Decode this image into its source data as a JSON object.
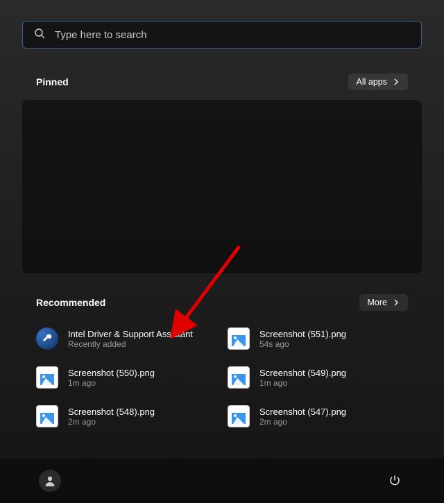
{
  "search": {
    "placeholder": "Type here to search"
  },
  "pinned": {
    "title": "Pinned",
    "all_apps_label": "All apps"
  },
  "recommended": {
    "title": "Recommended",
    "more_label": "More",
    "items": [
      {
        "title": "Intel Driver & Support Assistant",
        "subtitle": "Recently added",
        "icon": "intel"
      },
      {
        "title": "Screenshot (551).png",
        "subtitle": "54s ago",
        "icon": "image"
      },
      {
        "title": "Screenshot (550).png",
        "subtitle": "1m ago",
        "icon": "image"
      },
      {
        "title": "Screenshot (549).png",
        "subtitle": "1m ago",
        "icon": "image"
      },
      {
        "title": "Screenshot (548).png",
        "subtitle": "2m ago",
        "icon": "image"
      },
      {
        "title": "Screenshot (547).png",
        "subtitle": "2m ago",
        "icon": "image"
      }
    ]
  }
}
